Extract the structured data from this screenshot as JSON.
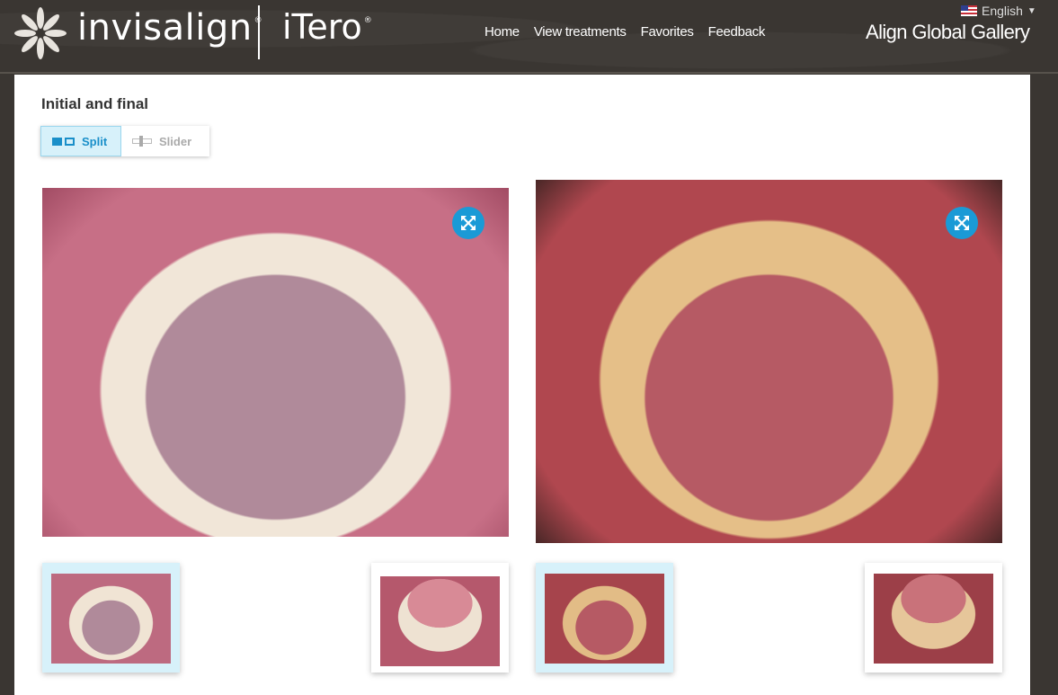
{
  "header": {
    "brand_primary": "invisalign",
    "brand_secondary": "iTero",
    "registered_mark": "®",
    "nav": [
      "Home",
      "View treatments",
      "Favorites",
      "Feedback"
    ],
    "language": "English",
    "gallery_title": "Align Global Gallery"
  },
  "main": {
    "section_title": "Initial and final",
    "view_toggle": {
      "split_label": "Split",
      "slider_label": "Slider",
      "selected": "Split"
    }
  },
  "icons": {
    "logo": "star-logo-icon",
    "flag": "us-flag-icon",
    "language_caret": "chevron-down-icon",
    "expand": "expand-icon",
    "split": "split-view-icon",
    "slider": "slider-view-icon"
  },
  "colors": {
    "header_bg": "#3a3632",
    "accent": "#1a9ad6",
    "selected_bg": "#d7f1fa"
  }
}
